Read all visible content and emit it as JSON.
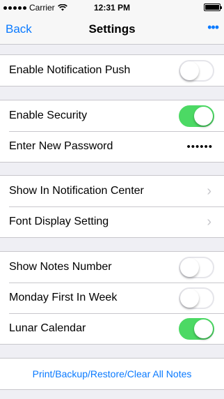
{
  "status_bar": {
    "carrier": "Carrier",
    "time": "12:31 PM"
  },
  "nav": {
    "back_label": "Back",
    "title": "Settings",
    "more_label": "•••"
  },
  "groups": [
    {
      "rows": [
        {
          "label": "Enable Notification Push",
          "toggle_on": false
        }
      ]
    },
    {
      "rows": [
        {
          "label": "Enable Security",
          "toggle_on": true
        },
        {
          "label": "Enter New Password",
          "value": "••••••"
        }
      ]
    },
    {
      "rows": [
        {
          "label": "Show In Notification Center"
        },
        {
          "label": "Font Display Setting"
        }
      ]
    },
    {
      "rows": [
        {
          "label": "Show Notes Number",
          "toggle_on": false
        },
        {
          "label": "Monday First In Week",
          "toggle_on": false
        },
        {
          "label": "Lunar Calendar",
          "toggle_on": true
        }
      ]
    },
    {
      "rows": [
        {
          "label": "Print/Backup/Restore/Clear All Notes"
        }
      ]
    }
  ],
  "colors": {
    "accent": "#0a7aff",
    "toggle_on": "#4cd964",
    "background": "#efeff4"
  }
}
